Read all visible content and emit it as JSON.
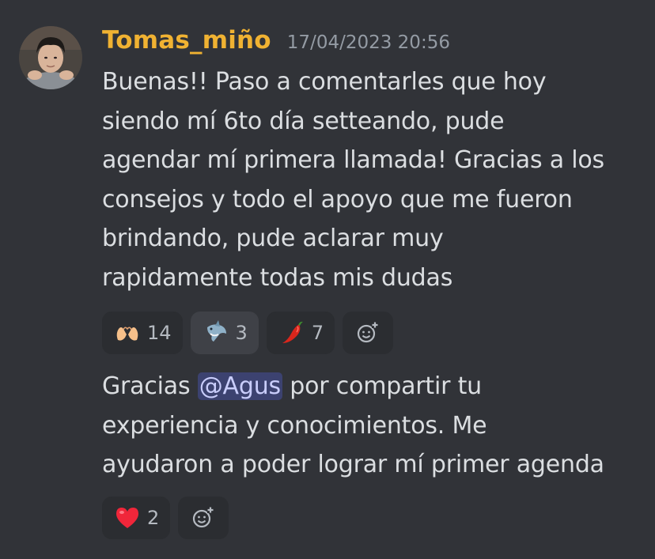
{
  "author": {
    "name": "Tomas_miño",
    "timestamp": "17/04/2023 20:56",
    "name_color": "#f0b232"
  },
  "messages": [
    {
      "lines": [
        "Buenas!! Paso a comentarles que hoy",
        "siendo mí 6to día setteando, pude",
        "agendar mí primera llamada! Gracias a los",
        "consejos y todo el apoyo que me fueron",
        "brindando, pude aclarar muy",
        "rapidamente todas mis dudas"
      ],
      "reactions": [
        {
          "emoji": "heart-hands-icon",
          "count": "14",
          "selected": false
        },
        {
          "emoji": "shark-icon",
          "count": "3",
          "selected": true
        },
        {
          "emoji": "hot-pepper-icon",
          "count": "7",
          "selected": false
        }
      ]
    },
    {
      "line1_before": "Gracias ",
      "mention": "@Agus",
      "line1_after": " por compartir tu",
      "lines": [
        "experiencia y conocimientos. Me",
        "ayudaron a poder lograr mí primer agenda"
      ],
      "reactions": [
        {
          "emoji": "red-heart-icon",
          "count": "2",
          "selected": false
        }
      ]
    }
  ]
}
